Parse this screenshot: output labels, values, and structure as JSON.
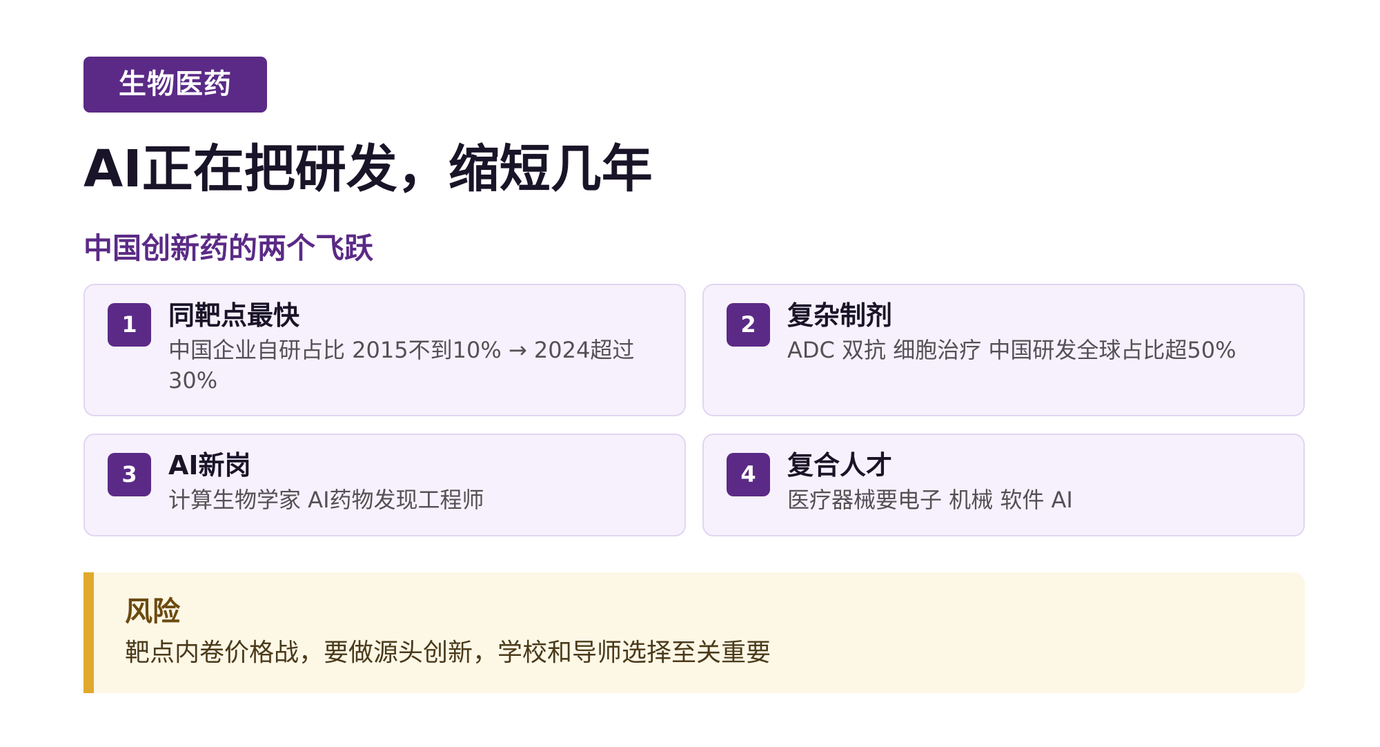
{
  "tag": "生物医药",
  "title": "AI正在把研发，缩短几年",
  "subtitle": "中国创新药的两个飞跃",
  "cards": [
    {
      "number": "1",
      "title": "同靶点最快",
      "desc": "中国企业自研占比 2015不到10% → 2024超过30%"
    },
    {
      "number": "2",
      "title": "复杂制剂",
      "desc": "ADC 双抗 细胞治疗 中国研发全球占比超50%"
    },
    {
      "number": "3",
      "title": "AI新岗",
      "desc": "计算生物学家 AI药物发现工程师"
    },
    {
      "number": "4",
      "title": "复合人才",
      "desc": "医疗器械要电子 机械 软件 AI"
    }
  ],
  "risk": {
    "title": "风险",
    "desc": "靶点内卷价格战，要做源头创新，学校和导师选择至关重要"
  },
  "colors": {
    "accent": "#5b2a86",
    "card_bg": "#f6f1fc",
    "risk_bar": "#e0a92e",
    "risk_bg": "#fdf7e6"
  }
}
